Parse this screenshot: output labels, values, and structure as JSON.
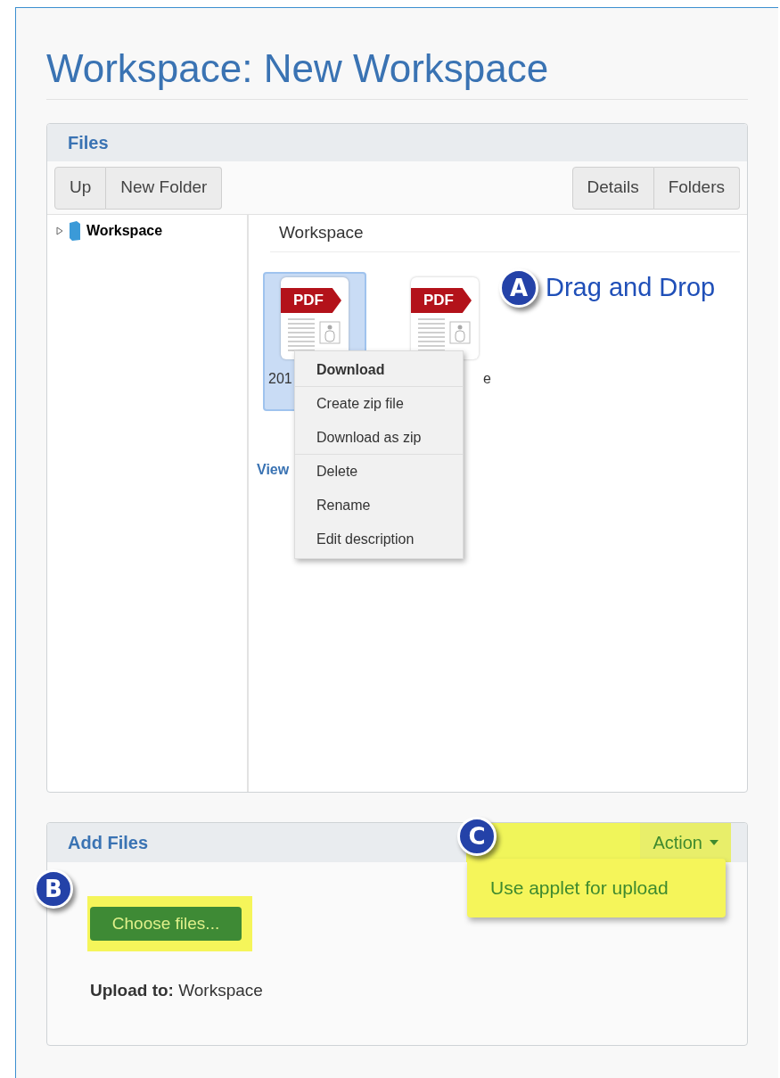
{
  "title": "Workspace: New Workspace",
  "files_panel": {
    "title": "Files",
    "toolbar_left": [
      "Up",
      "New Folder"
    ],
    "toolbar_right": [
      "Details",
      "Folders"
    ],
    "tree": [
      {
        "label": "Workspace",
        "expanded": false
      }
    ],
    "folder_heading": "Workspace",
    "tiles": [
      {
        "badge": "PDF",
        "name": "201",
        "selected": true
      },
      {
        "badge": "PDF",
        "name": "e",
        "selected": false
      }
    ],
    "link": "View",
    "context_menu": [
      {
        "label": "Download",
        "default": true,
        "separator_after": true
      },
      {
        "label": "Create zip file",
        "default": false,
        "separator_after": false
      },
      {
        "label": "Download as zip",
        "default": false,
        "separator_after": true
      },
      {
        "label": "Delete",
        "default": false,
        "separator_after": false
      },
      {
        "label": "Rename",
        "default": false,
        "separator_after": false
      },
      {
        "label": "Edit description",
        "default": false,
        "separator_after": false
      }
    ]
  },
  "callouts": [
    {
      "letter": "A",
      "text": "Drag and Drop"
    },
    {
      "letter": "B"
    },
    {
      "letter": "C"
    }
  ],
  "add_files_panel": {
    "title": "Add Files",
    "action": "Action",
    "action_menu": [
      "Use applet for upload"
    ],
    "choose_button": "Choose files...",
    "upload_to": "**Upload to:** Workspace"
  }
}
